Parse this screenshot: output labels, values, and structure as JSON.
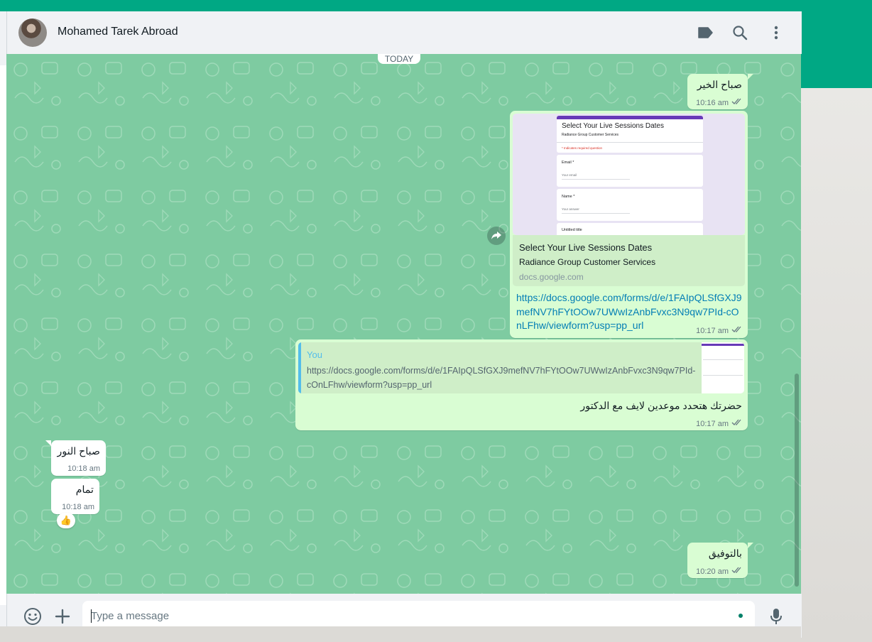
{
  "header": {
    "contact_name": "Mohamed Tarek Abroad",
    "icons": [
      "label-icon",
      "search-icon",
      "menu-icon"
    ]
  },
  "chat": {
    "day_label": "TODAY",
    "messages": [
      {
        "dir": "out",
        "text": "صباح الخير",
        "time": "10:16 am"
      },
      {
        "dir": "out",
        "preview_title": "Select Your Live Sessions Dates",
        "preview_description": "Radiance Group Customer Services",
        "preview_host": "docs.google.com",
        "form": {
          "title": "Select Your Live Sessions Dates",
          "subtitle": "Radiance Group Customer Services",
          "required_note": "* Indicates required question",
          "email_label": "Email *",
          "email_placeholder": "Your email",
          "name_label": "Name *",
          "name_placeholder": "Your answer",
          "untitled": "Untitled title"
        },
        "link": "https://docs.google.com/forms/d/e/1FAIpQLSfGXJ9mefNV7hFYtOOw7UWwIzAnbFvxc3N9qw7PId-cOnLFhw/viewform?usp=pp_url",
        "time": "10:17 am"
      },
      {
        "dir": "out",
        "quote_author": "You",
        "quote_text": "https://docs.google.com/forms/d/e/1FAIpQLSfGXJ9mefNV7hFYtOOw7UWwIzAnbFvxc3N9qw7PId-cOnLFhw/viewform?usp=pp_url",
        "text": "حضرتك هتحدد موعدين لايف مع الدكتور",
        "time": "10:17 am"
      },
      {
        "dir": "in",
        "text": "صباح النور",
        "time": "10:18 am"
      },
      {
        "dir": "in",
        "text": "تمام",
        "time": "10:18 am",
        "reaction": "👍"
      },
      {
        "dir": "out",
        "text": "بالتوفيق",
        "time": "10:20 am"
      }
    ]
  },
  "composer": {
    "placeholder": "Type a message",
    "icons": [
      "emoji-icon",
      "attach-plus-icon",
      "microphone-icon"
    ]
  },
  "colors": {
    "brand": "#00a884",
    "chat_background": "#7ecba1",
    "outgoing_bubble": "#d9fdd3",
    "incoming_bubble": "#ffffff",
    "link": "#027eb5",
    "quote_author": "#53bdeb"
  }
}
